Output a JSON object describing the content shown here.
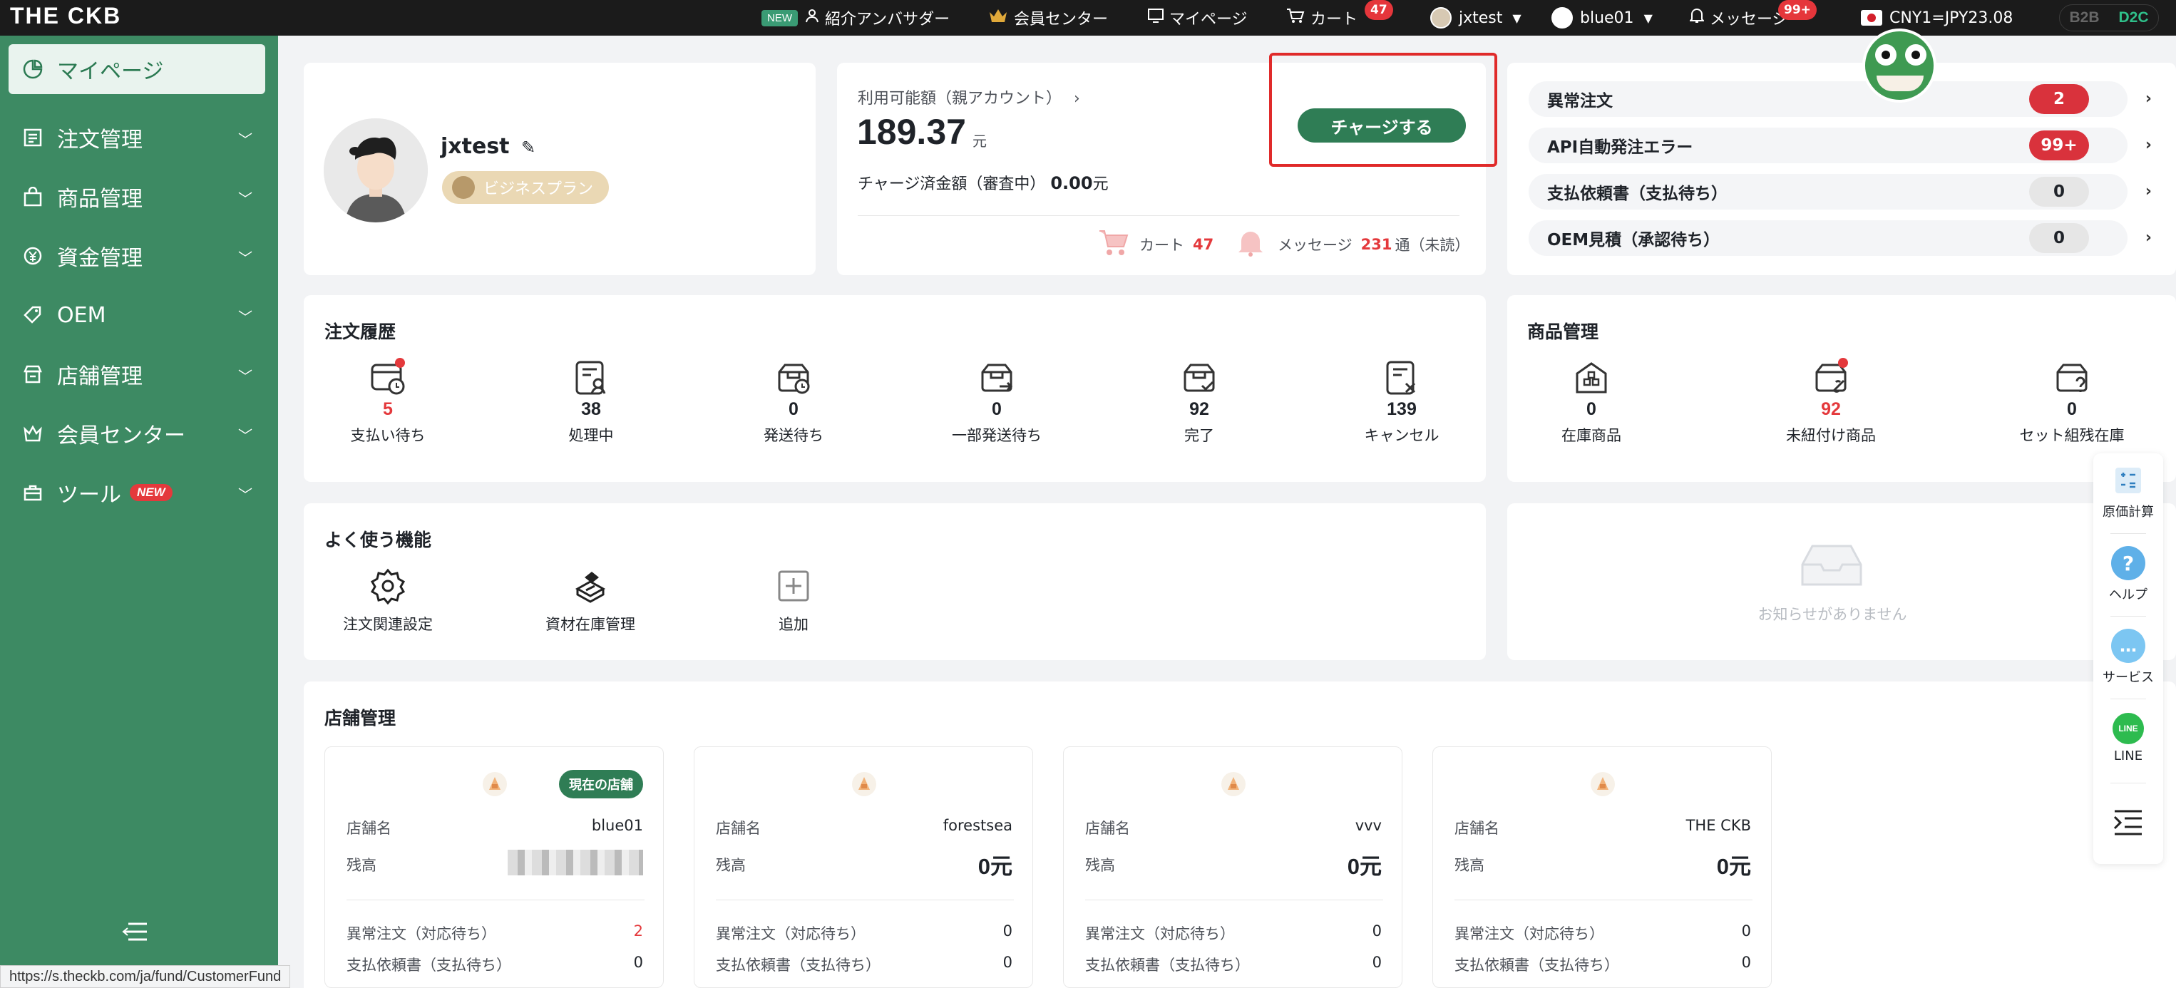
{
  "topbar": {
    "brand": "THE CKB",
    "new_badge": "NEW",
    "ambassador": "紹介アンバサダー",
    "member_center": "会員センター",
    "mypage": "マイページ",
    "cart": "カート",
    "cart_count": "47",
    "user": "jxtest",
    "store": "blue01",
    "messages": "メッセージ",
    "messages_count": "99+",
    "rate": "CNY1=JPY23.08",
    "b2b": "B2B",
    "d2c": "D2C"
  },
  "sidebar": {
    "items": [
      {
        "label": "マイページ",
        "icon": "dashboard-icon"
      },
      {
        "label": "注文管理",
        "icon": "order-icon"
      },
      {
        "label": "商品管理",
        "icon": "bag-icon"
      },
      {
        "label": "資金管理",
        "icon": "yen-icon"
      },
      {
        "label": "OEM",
        "icon": "tag-icon"
      },
      {
        "label": "店舗管理",
        "icon": "store-icon"
      },
      {
        "label": "会員センター",
        "icon": "crown-icon"
      },
      {
        "label": "ツール",
        "icon": "toolbox-icon",
        "badge": "NEW"
      }
    ]
  },
  "profile": {
    "username": "jxtest",
    "plan": "ビジネスプラン"
  },
  "balance": {
    "label": "利用可能額（親アカウント）",
    "value": "189.37",
    "unit": "元",
    "charged_label": "チャージ済金額（審査中）",
    "charged_value": "0.00",
    "charged_unit": "元",
    "charge_button": "チャージする",
    "cart_label": "カート",
    "cart_count": "47",
    "message_label": "メッセージ",
    "message_count": "231",
    "message_suffix": "通（未読）"
  },
  "alerts": [
    {
      "label": "異常注文",
      "count": "2",
      "style": "red"
    },
    {
      "label": "API自動発注エラー",
      "count": "99+",
      "style": "red"
    },
    {
      "label": "支払依頼書（支払待ち）",
      "count": "0",
      "style": "gray"
    },
    {
      "label": "OEM見積（承認待ち）",
      "count": "0",
      "style": "gray"
    }
  ],
  "order_history": {
    "title": "注文履歴",
    "stats": [
      {
        "num": "5",
        "label": "支払い待ち"
      },
      {
        "num": "38",
        "label": "処理中"
      },
      {
        "num": "0",
        "label": "発送待ち"
      },
      {
        "num": "0",
        "label": "一部発送待ち"
      },
      {
        "num": "92",
        "label": "完了"
      },
      {
        "num": "139",
        "label": "キャンセル"
      }
    ]
  },
  "product_mgmt": {
    "title": "商品管理",
    "stats": [
      {
        "num": "0",
        "label": "在庫商品"
      },
      {
        "num": "92",
        "label": "未紐付け商品"
      },
      {
        "num": "0",
        "label": "セット組残在庫"
      }
    ]
  },
  "quick_functions": {
    "title": "よく使う機能",
    "items": [
      {
        "label": "注文関連設定",
        "icon": "gear-icon"
      },
      {
        "label": "資材在庫管理",
        "icon": "materials-icon"
      },
      {
        "label": "追加",
        "icon": "plus-icon"
      }
    ]
  },
  "notices": {
    "empty_text": "お知らせがありません"
  },
  "stores": {
    "title": "店舗管理",
    "current_badge": "現在の店舗",
    "name_label": "店舗名",
    "balance_label": "残高",
    "abnormal_label": "異常注文（対応待ち）",
    "payment_label": "支払依頼書（支払待ち）",
    "list": [
      {
        "name": "blue01",
        "balance": "",
        "abnormal": "2",
        "payment": "0"
      },
      {
        "name": "forestsea",
        "balance": "0元",
        "abnormal": "0",
        "payment": "0"
      },
      {
        "name": "vvv",
        "balance": "0元",
        "abnormal": "0",
        "payment": "0"
      },
      {
        "name": "THE CKB",
        "balance": "0元",
        "abnormal": "0",
        "payment": "0"
      }
    ]
  },
  "floatbar": {
    "cost": "原価計算",
    "help": "ヘルプ",
    "service": "サービス",
    "line": "LINE",
    "line_logo": "LINE"
  },
  "status_url": "https://s.theckb.com/ja/fund/CustomerFund",
  "colors": {
    "sidebar": "#3d8a63",
    "primary": "#2f7d55",
    "alert_red": "#d9323c",
    "highlight_frame": "#e02a2a"
  }
}
